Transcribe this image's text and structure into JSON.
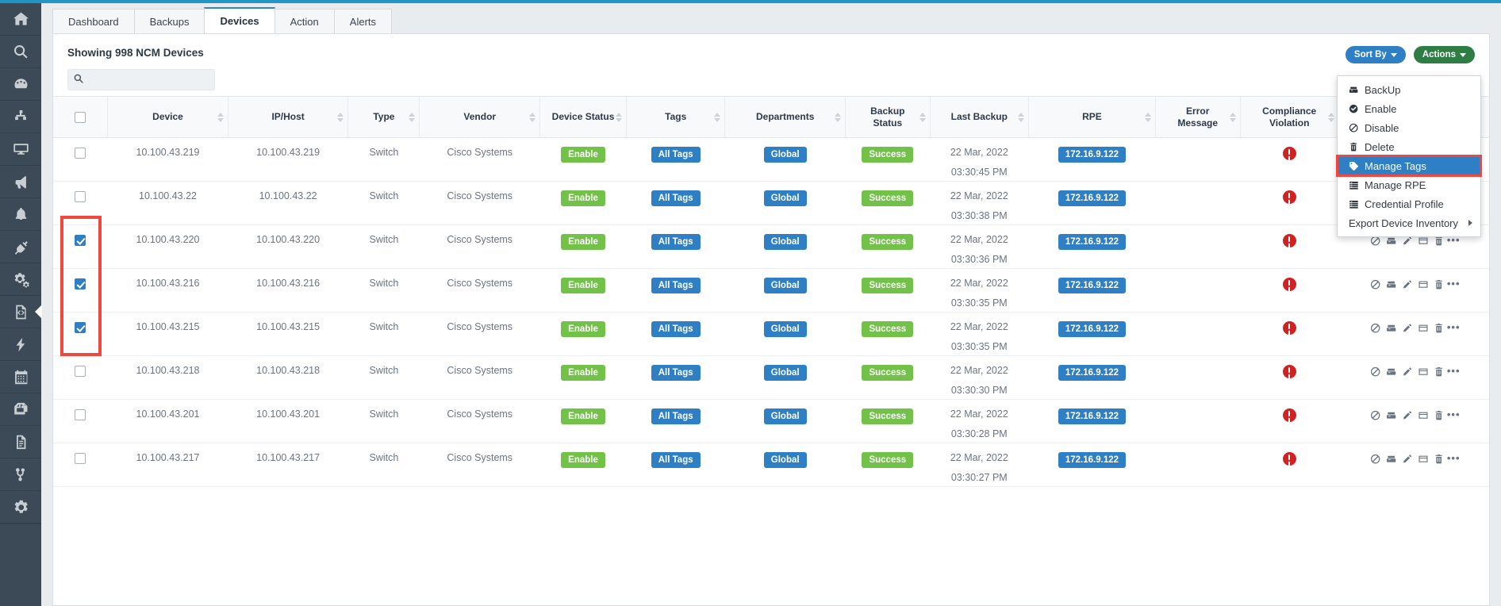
{
  "sidebar": {
    "items": [
      {
        "name": "home-icon",
        "label": "Home"
      },
      {
        "name": "search-icon",
        "label": "Search"
      },
      {
        "name": "dashboard-gauge-icon",
        "label": "Dashboard"
      },
      {
        "name": "network-topology-icon",
        "label": "Topology"
      },
      {
        "name": "monitor-icon",
        "label": "Monitor"
      },
      {
        "name": "megaphone-icon",
        "label": "Announcements"
      },
      {
        "name": "bell-icon",
        "label": "Alerts"
      },
      {
        "name": "plug-icon",
        "label": "Integrations"
      },
      {
        "name": "gears-icon",
        "label": "Automation"
      },
      {
        "name": "code-file-icon",
        "label": "Configuration"
      },
      {
        "name": "bolt-icon",
        "label": "Actions"
      },
      {
        "name": "calendar-icon",
        "label": "Schedule"
      },
      {
        "name": "copy-icon",
        "label": "Templates"
      },
      {
        "name": "document-icon",
        "label": "Reports"
      },
      {
        "name": "branch-icon",
        "label": "Workflows"
      },
      {
        "name": "gear-icon",
        "label": "Settings"
      }
    ],
    "active_index": 9
  },
  "tabs": [
    {
      "label": "Dashboard",
      "active": false
    },
    {
      "label": "Backups",
      "active": false
    },
    {
      "label": "Devices",
      "active": true
    },
    {
      "label": "Action",
      "active": false
    },
    {
      "label": "Alerts",
      "active": false
    }
  ],
  "header": {
    "showing_text": "Showing 998 NCM Devices",
    "search_placeholder": "",
    "search_value": "",
    "sort_by_label": "Sort By",
    "actions_label": "Actions"
  },
  "actions_menu": {
    "items": [
      {
        "label": "BackUp",
        "icon": "backup-icon",
        "highlighted": false,
        "submenu": false
      },
      {
        "label": "Enable",
        "icon": "check-circle-icon",
        "highlighted": false,
        "submenu": false
      },
      {
        "label": "Disable",
        "icon": "ban-icon",
        "highlighted": false,
        "submenu": false
      },
      {
        "label": "Delete",
        "icon": "trash-icon",
        "highlighted": false,
        "submenu": false
      },
      {
        "label": "Manage Tags",
        "icon": "tag-icon",
        "highlighted": true,
        "submenu": false
      },
      {
        "label": "Manage RPE",
        "icon": "server-icon",
        "highlighted": false,
        "submenu": false
      },
      {
        "label": "Credential Profile",
        "icon": "server-icon",
        "highlighted": false,
        "submenu": false
      },
      {
        "label": "Export Device Inventory",
        "icon": "none",
        "highlighted": false,
        "submenu": true
      }
    ]
  },
  "table": {
    "columns": [
      {
        "label": "",
        "key": "select",
        "sortable": false
      },
      {
        "label": "Device",
        "key": "device",
        "sortable": true
      },
      {
        "label": "IP/Host",
        "key": "ip_host",
        "sortable": true
      },
      {
        "label": "Type",
        "key": "type",
        "sortable": true
      },
      {
        "label": "Vendor",
        "key": "vendor",
        "sortable": true
      },
      {
        "label": "Device Status",
        "key": "device_status",
        "sortable": true
      },
      {
        "label": "Tags",
        "key": "tags",
        "sortable": true
      },
      {
        "label": "Departments",
        "key": "departments",
        "sortable": true
      },
      {
        "label": "Backup Status",
        "key": "backup_status",
        "sortable": true
      },
      {
        "label": "Last Backup",
        "key": "last_backup",
        "sortable": true
      },
      {
        "label": "RPE",
        "key": "rpe",
        "sortable": true
      },
      {
        "label": "Error Message",
        "key": "error_message",
        "sortable": true
      },
      {
        "label": "Compliance Violation",
        "key": "compliance_violation",
        "sortable": true
      },
      {
        "label": "",
        "key": "actions",
        "sortable": false
      }
    ],
    "header_select_all_checked": false,
    "rows": [
      {
        "selected": false,
        "device": "10.100.43.219",
        "ip_host": "10.100.43.219",
        "type": "Switch",
        "vendor": "Cisco Systems",
        "device_status": "Enable",
        "tags": "All Tags",
        "departments": "Global",
        "backup_status": "Success",
        "backup_date": "22 Mar, 2022",
        "backup_time": "03:30:45 PM",
        "rpe": "172.16.9.122",
        "error_message": "",
        "compliance_violation": "error"
      },
      {
        "selected": false,
        "device": "10.100.43.22",
        "ip_host": "10.100.43.22",
        "type": "Switch",
        "vendor": "Cisco Systems",
        "device_status": "Enable",
        "tags": "All Tags",
        "departments": "Global",
        "backup_status": "Success",
        "backup_date": "22 Mar, 2022",
        "backup_time": "03:30:38 PM",
        "rpe": "172.16.9.122",
        "error_message": "",
        "compliance_violation": "error"
      },
      {
        "selected": true,
        "device": "10.100.43.220",
        "ip_host": "10.100.43.220",
        "type": "Switch",
        "vendor": "Cisco Systems",
        "device_status": "Enable",
        "tags": "All Tags",
        "departments": "Global",
        "backup_status": "Success",
        "backup_date": "22 Mar, 2022",
        "backup_time": "03:30:36 PM",
        "rpe": "172.16.9.122",
        "error_message": "",
        "compliance_violation": "error"
      },
      {
        "selected": true,
        "device": "10.100.43.216",
        "ip_host": "10.100.43.216",
        "type": "Switch",
        "vendor": "Cisco Systems",
        "device_status": "Enable",
        "tags": "All Tags",
        "departments": "Global",
        "backup_status": "Success",
        "backup_date": "22 Mar, 2022",
        "backup_time": "03:30:35 PM",
        "rpe": "172.16.9.122",
        "error_message": "",
        "compliance_violation": "error"
      },
      {
        "selected": true,
        "device": "10.100.43.215",
        "ip_host": "10.100.43.215",
        "type": "Switch",
        "vendor": "Cisco Systems",
        "device_status": "Enable",
        "tags": "All Tags",
        "departments": "Global",
        "backup_status": "Success",
        "backup_date": "22 Mar, 2022",
        "backup_time": "03:30:35 PM",
        "rpe": "172.16.9.122",
        "error_message": "",
        "compliance_violation": "error"
      },
      {
        "selected": false,
        "device": "10.100.43.218",
        "ip_host": "10.100.43.218",
        "type": "Switch",
        "vendor": "Cisco Systems",
        "device_status": "Enable",
        "tags": "All Tags",
        "departments": "Global",
        "backup_status": "Success",
        "backup_date": "22 Mar, 2022",
        "backup_time": "03:30:30 PM",
        "rpe": "172.16.9.122",
        "error_message": "",
        "compliance_violation": "error"
      },
      {
        "selected": false,
        "device": "10.100.43.201",
        "ip_host": "10.100.43.201",
        "type": "Switch",
        "vendor": "Cisco Systems",
        "device_status": "Enable",
        "tags": "All Tags",
        "departments": "Global",
        "backup_status": "Success",
        "backup_date": "22 Mar, 2022",
        "backup_time": "03:30:28 PM",
        "rpe": "172.16.9.122",
        "error_message": "",
        "compliance_violation": "error"
      },
      {
        "selected": false,
        "device": "10.100.43.217",
        "ip_host": "10.100.43.217",
        "type": "Switch",
        "vendor": "Cisco Systems",
        "device_status": "Enable",
        "tags": "All Tags",
        "departments": "Global",
        "backup_status": "Success",
        "backup_date": "22 Mar, 2022",
        "backup_time": "03:30:27 PM",
        "rpe": "172.16.9.122",
        "error_message": "",
        "compliance_violation": "error"
      }
    ],
    "row_action_icons": [
      "ban-icon",
      "backup-icon",
      "pencil-icon",
      "window-icon",
      "trash-icon",
      "ellipsis-icon"
    ]
  },
  "colors": {
    "accent_blue": "#2196c4",
    "button_blue": "#2e7fc4",
    "button_green": "#2e7d45",
    "badge_green": "#72c24a",
    "badge_blue": "#2e7fc4",
    "error_red": "#cf2222",
    "highlight_red": "#f0483e",
    "sidebar_bg": "#3b4a56"
  }
}
